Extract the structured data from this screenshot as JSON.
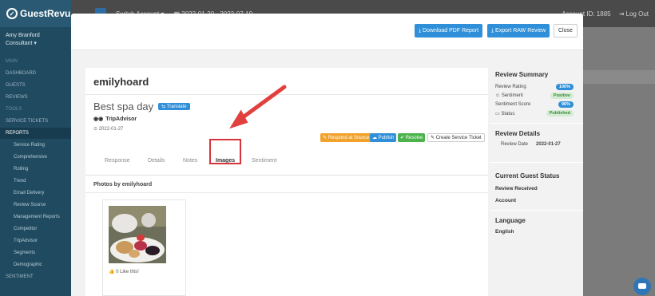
{
  "app": {
    "logo": "GuestRevu",
    "user_name": "Amy Branford",
    "user_role": "Consultant",
    "topbar_switch": "Switch Account",
    "topbar_date": "2022-01-20 - 2022-07-19",
    "topbar_account": "Account ID: 1885",
    "topbar_logout": "Log Out"
  },
  "sidebar": {
    "items": [
      {
        "label": "MAIN",
        "kind": "section"
      },
      {
        "label": "DASHBOARD",
        "kind": "item"
      },
      {
        "label": "GUESTS",
        "kind": "item"
      },
      {
        "label": "REVIEWS",
        "kind": "item"
      },
      {
        "label": "TOOLS",
        "kind": "section"
      },
      {
        "label": "SERVICE TICKETS",
        "kind": "item"
      },
      {
        "label": "REPORTS",
        "kind": "active"
      },
      {
        "label": "Service Rating",
        "kind": "sub"
      },
      {
        "label": "Comprehensive",
        "kind": "sub"
      },
      {
        "label": "Rolling",
        "kind": "sub"
      },
      {
        "label": "Trend",
        "kind": "sub"
      },
      {
        "label": "Email Delivery",
        "kind": "sub"
      },
      {
        "label": "Review Source",
        "kind": "sub"
      },
      {
        "label": "Management Reports",
        "kind": "sub"
      },
      {
        "label": "Competitor",
        "kind": "sub"
      },
      {
        "label": "TripAdvisor",
        "kind": "sub"
      },
      {
        "label": "Segments",
        "kind": "sub"
      },
      {
        "label": "Demographic",
        "kind": "sub"
      },
      {
        "label": "SENTIMENT",
        "kind": "item"
      }
    ]
  },
  "modal": {
    "buttons": {
      "download_pdf": "Download PDF Report",
      "export_raw": "Export RAW Review",
      "close": "Close"
    },
    "author": "emilyhoard",
    "review_title": "Best spa day",
    "translate_label": "Translate",
    "source": "TripAdvisor",
    "date": "2022-01-27",
    "actions": {
      "respond": "Respond at Source",
      "publish": "Publish",
      "resolve": "Resolve",
      "ticket": "Create Service Ticket"
    },
    "tabs": [
      "Response",
      "Details",
      "Notes",
      "Images",
      "Sentiment"
    ],
    "active_tab": "Images",
    "photos_label": "Photos by emilyhoard",
    "like_text": "0 Like this!"
  },
  "summary": {
    "title": "Review Summary",
    "rows": [
      {
        "label": "Review Rating",
        "badge": "100%",
        "badge_style": "blue"
      },
      {
        "label": "Sentiment",
        "badge": "Positive",
        "badge_style": "green"
      },
      {
        "label": "Sentiment Score",
        "badge": "96%",
        "badge_style": "blue"
      },
      {
        "label": "Status",
        "badge": "Published",
        "badge_style": "green"
      }
    ],
    "details_title": "Review Details",
    "review_date_label": "Review Date",
    "review_date_value": "2022-01-27",
    "guest_status_title": "Current Guest Status",
    "guest_status_lines": [
      "Review Received",
      "Account"
    ],
    "language_title": "Language",
    "language_value": "English"
  },
  "colors": {
    "accent_blue": "#2f8fd8",
    "annotation_red": "#d6343a",
    "sidebar": "#1f4a60"
  }
}
